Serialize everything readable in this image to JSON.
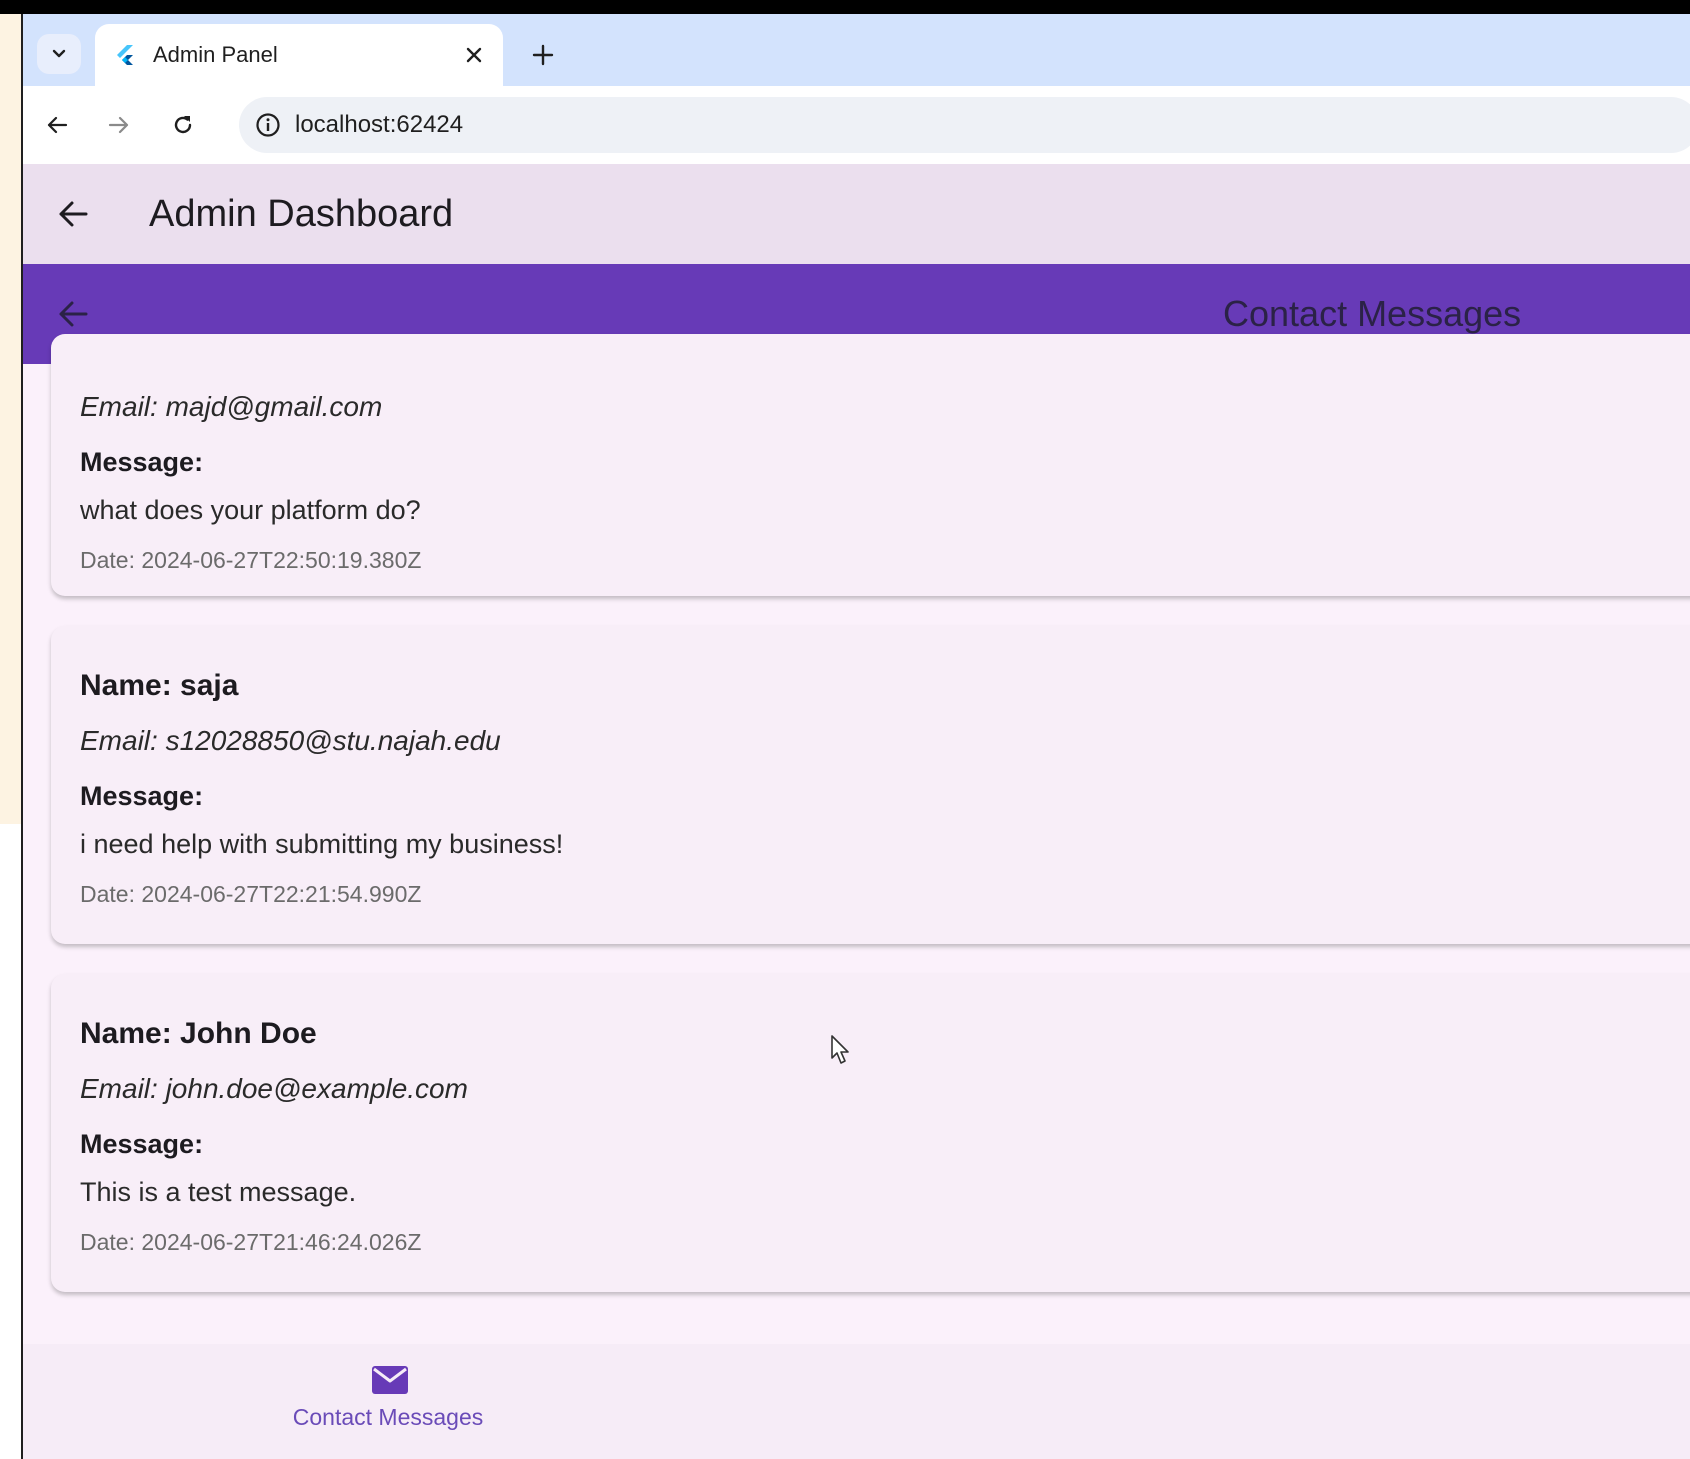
{
  "browser": {
    "tab_title": "Admin Panel",
    "url": "localhost:62424"
  },
  "app_bar": {
    "title": "Admin Dashboard"
  },
  "sub_bar": {
    "title": "Contact Messages",
    "color": "#673ab7"
  },
  "messages": [
    {
      "name": "",
      "email": "Email: majd@gmail.com",
      "message_label": "Message:",
      "message": "what does your platform do?",
      "date": "Date: 2024-06-27T22:50:19.380Z"
    },
    {
      "name": "Name: saja",
      "email": "Email: s12028850@stu.najah.edu",
      "message_label": "Message:",
      "message": "i need help with submitting my business!",
      "date": "Date: 2024-06-27T22:21:54.990Z"
    },
    {
      "name": "Name: John Doe",
      "email": "Email: john.doe@example.com",
      "message_label": "Message:",
      "message": "This is a test message.",
      "date": "Date: 2024-06-27T21:46:24.026Z"
    }
  ],
  "bottom_nav": {
    "items": [
      {
        "label": "Contact Messages",
        "icon": "mail-icon"
      }
    ]
  }
}
